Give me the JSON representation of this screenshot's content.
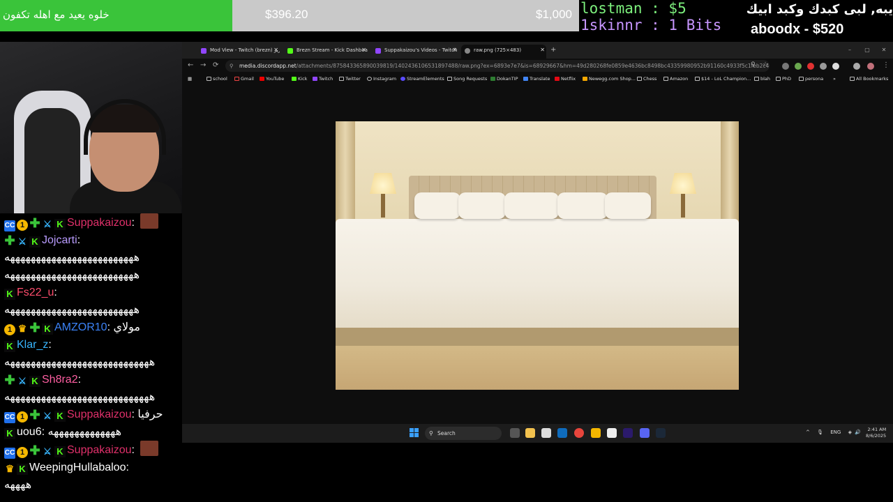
{
  "overlay": {
    "goal_label": "خلوه يعيد مع اهله تكفون",
    "goal_current": "$396.20",
    "goal_target": "$1,000",
    "goal_progress_fraction": 0.3962,
    "recent_events": [
      "lostman : $5",
      "1skinnr : 1 Bits"
    ],
    "top_donation_message": "يبه, لبى كبدك وكبد ابيك",
    "top_donation_amount": "aboodx - $520"
  },
  "chat": {
    "messages": [
      {
        "user": "Suppakaizou",
        "user_color": "#e0306a",
        "text": "",
        "badges": [
          "cc",
          "coin",
          "plus",
          "sword",
          "kick"
        ],
        "emote": true,
        "partial": true
      },
      {
        "user": "Jojcarti",
        "user_color": "#b99cff",
        "text": "",
        "badges": [
          "plus",
          "sword",
          "kick"
        ]
      },
      {
        "user": "",
        "text": "هههههههههههههههههههههههههه"
      },
      {
        "user": "",
        "text": "هههههههههههههههههههههههههه"
      },
      {
        "user": "Fs22_u",
        "user_color": "#ff4d6d",
        "text": "",
        "badges": [
          "kick"
        ]
      },
      {
        "user": "",
        "text": "هههههههههههههههههههههههههه"
      },
      {
        "user": "AMZOR10",
        "user_color": "#3b82f6",
        "text": "مولاي",
        "badges": [
          "coin",
          "crown",
          "plus",
          "kick"
        ]
      },
      {
        "user": "Klar_z",
        "user_color": "#38b6ff",
        "text": "",
        "badges": [
          "kick"
        ]
      },
      {
        "user": "",
        "text": "ههههههههههههههههههههههههههههه"
      },
      {
        "user": "Sh8ra2",
        "user_color": "#ff5fa2",
        "text": "",
        "badges": [
          "plus",
          "sword",
          "kick"
        ]
      },
      {
        "user": "",
        "text": "ههههههههههههههههههههههههههههه"
      },
      {
        "user": "Suppakaizou",
        "user_color": "#e0306a",
        "text": "حرفيا",
        "badges": [
          "cc",
          "coin",
          "plus",
          "sword",
          "kick"
        ]
      },
      {
        "user": "uou6",
        "user_color": "#ffffff",
        "text": "هههههههههههههه",
        "badges": [
          "kick"
        ]
      },
      {
        "user": "Suppakaizou",
        "user_color": "#e0306a",
        "text": "",
        "badges": [
          "cc",
          "coin",
          "plus",
          "sword",
          "kick"
        ],
        "emote": true
      },
      {
        "user": "WeepingHullabaloo",
        "user_color": "#ffffff",
        "text": "",
        "badges": [
          "crown",
          "kick"
        ]
      },
      {
        "user": "",
        "text": "ههههه"
      }
    ]
  },
  "browser": {
    "tabs": [
      {
        "label": "Mod View - Twitch (brezn) بريز",
        "icon_color": "#9146ff"
      },
      {
        "label": "Brezn Stream - Kick Dashboard",
        "icon_color": "#53fc18"
      },
      {
        "label": "Suppakaizou's Videos - Twitch",
        "icon_color": "#9146ff"
      },
      {
        "label": "raw.png (725×483)",
        "icon_color": "#888888",
        "active": true
      }
    ],
    "new_tab": "+",
    "window_controls": [
      "–",
      "▢",
      "✕"
    ],
    "url_host": "media.discordapp.net",
    "url_rest": "/attachments/875843365890039819/1402436106531897488/raw.png?ex=6893e7e7&is=68929667&hm=49d280268fe0859e4636bc8498bc43359980952b91160c4933f5c1feb2c40533&=&format=we...",
    "bookmarks": [
      "school",
      "Gmail",
      "YouTube",
      "Kick",
      "Twitch",
      "Twitter",
      "Instagram",
      "StreamElements",
      "Song Requests",
      "DokanTIP",
      "Translate",
      "Netflix",
      "Newegg.com Shop...",
      "Chess",
      "Amazon",
      "$14 - LoL Champion...",
      "blah",
      "PhD",
      "persona"
    ],
    "bookmarks_overflow": "»",
    "all_bookmarks": "All Bookmarks"
  },
  "taskbar": {
    "search_placeholder": "Search",
    "tray_lang": "ENG",
    "time": "2:41 AM",
    "date": "8/6/2025"
  },
  "icons": {
    "back": "←",
    "forward": "→",
    "reload": "⟳",
    "site_info": "⚲",
    "zoom": "⚲",
    "star": "☆",
    "apps": "▦",
    "search": "⚲",
    "chevron_up": "^",
    "mic": "🎙",
    "speaker": "🔊",
    "wifi": "◈"
  },
  "colors": {
    "goal_fill": "#3ac43a",
    "goal_track": "#c9c9c9",
    "kick_green": "#53fc18"
  }
}
